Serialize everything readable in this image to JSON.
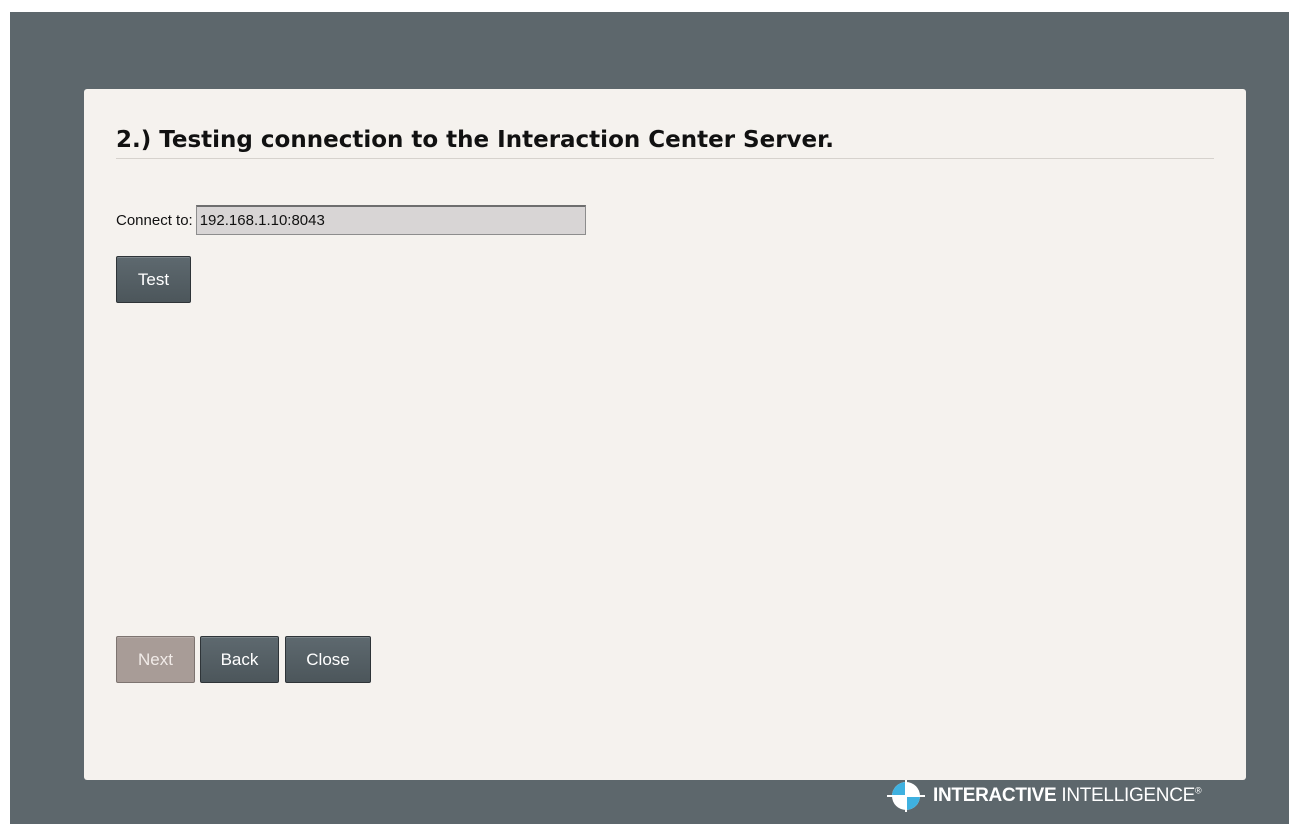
{
  "wizard": {
    "step_title": "2.) Testing connection to the Interaction Center Server.",
    "connect_label": "Connect to:",
    "connect_value": "192.168.1.10:8043",
    "test_label": "Test"
  },
  "footer_buttons": {
    "next_label": "Next",
    "back_label": "Back",
    "close_label": "Close",
    "next_enabled": false
  },
  "brand": {
    "name_strong": "INTERACTIVE",
    "name_light": " INTELLIGENCE",
    "trademark": "®",
    "logo_icon": "globe-cross-icon"
  },
  "colors": {
    "frame": "#5d676c",
    "panel": "#f5f2ee",
    "button": "#525c61",
    "button_disabled": "#a89c97",
    "logo_accent": "#3fb1e0"
  }
}
